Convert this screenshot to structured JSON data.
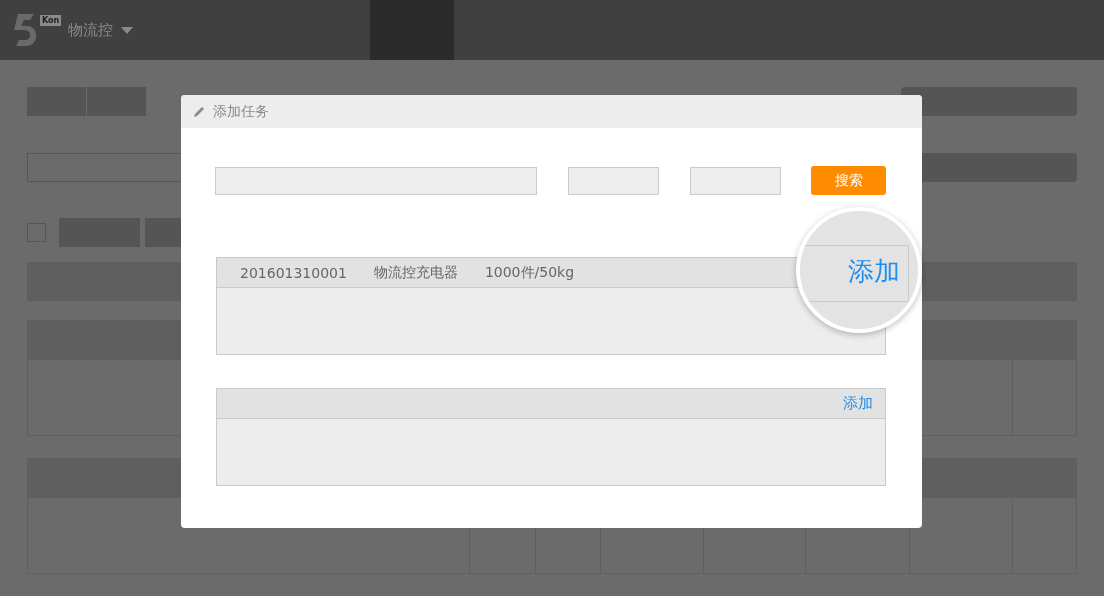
{
  "header": {
    "logo_badge": "Kon",
    "product": "物流控"
  },
  "background": {
    "select_all": {
      "checked": false
    }
  },
  "dialog": {
    "title": "添加任务",
    "search_button": "搜索",
    "result_list": {
      "rows": [
        {
          "code": "201601310001",
          "name": "物流控充电器",
          "quantity": "1000件/50kg"
        }
      ]
    },
    "magnifier": {
      "label": "添加"
    },
    "task_list": {
      "action": "添加"
    }
  }
}
